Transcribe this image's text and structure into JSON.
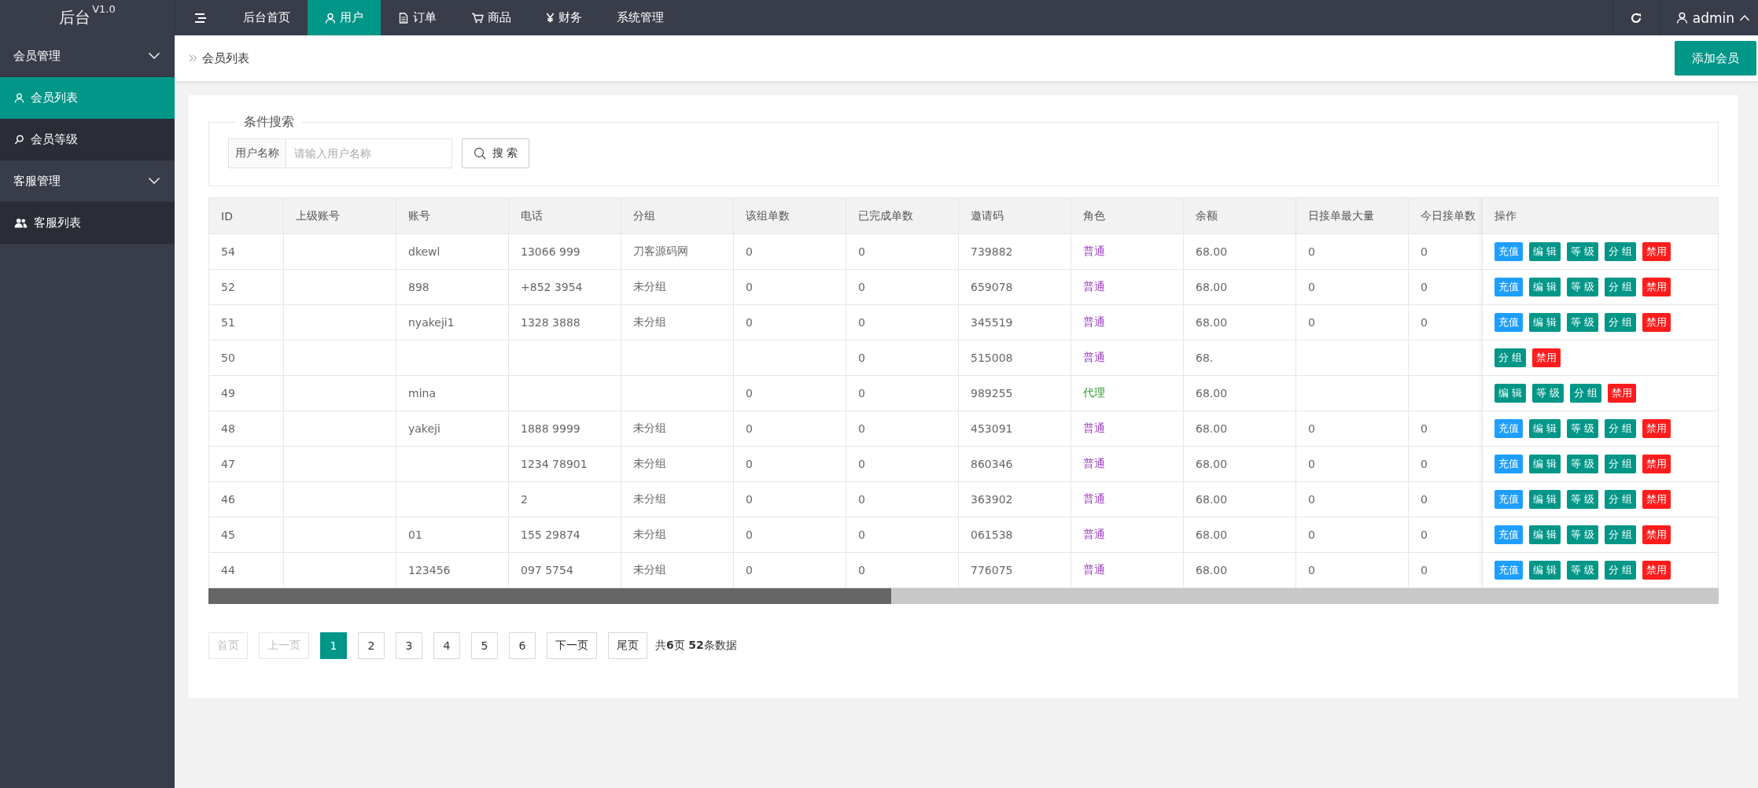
{
  "logo": {
    "text": "后台",
    "version": "V1.0"
  },
  "nav": [
    {
      "label": "后台首页",
      "selected": false
    },
    {
      "label": "用户",
      "selected": true
    },
    {
      "label": "订单",
      "selected": false
    },
    {
      "label": "商品",
      "selected": false
    },
    {
      "label": "财务",
      "selected": false
    },
    {
      "label": "系统管理",
      "selected": false
    }
  ],
  "user": {
    "name": "admin"
  },
  "sidebar": [
    {
      "label": "会员管理",
      "expanded": true,
      "children": [
        {
          "label": "会员列表",
          "selected": true
        },
        {
          "label": "会员等级",
          "selected": false
        }
      ]
    },
    {
      "label": "客服管理",
      "expanded": true,
      "children": [
        {
          "label": "客服列表",
          "selected": false
        }
      ]
    }
  ],
  "breadcrumb": "会员列表",
  "add_button": "添加会员",
  "search": {
    "legend": "条件搜索",
    "label": "用户名称",
    "placeholder": "请输入用户名称",
    "button": "搜 索"
  },
  "table": {
    "columns": [
      "ID",
      "上级账号",
      "账号",
      "电话",
      "分组",
      "该组单数",
      "已完成单数",
      "邀请码",
      "角色",
      "余额",
      "日接单最大量",
      "今日接单数"
    ],
    "action_column": "操作",
    "rows": [
      {
        "id": "54",
        "account": "dkewl",
        "phone": "13066 999",
        "group": "刀客源码网",
        "group_orders": "0",
        "done_orders": "0",
        "invite": "739882",
        "role": {
          "text": "普通",
          "color": "#9c3fc4"
        },
        "balance": "68.00",
        "daily_max": "0",
        "today_orders": "0",
        "actions": [
          {
            "label": "充值",
            "kind": "info"
          },
          {
            "label": "编 辑",
            "kind": "normal"
          },
          {
            "label": "等 级",
            "kind": "normal"
          },
          {
            "label": "分 组",
            "kind": "normal"
          },
          {
            "label": "禁用",
            "kind": "danger"
          }
        ]
      },
      {
        "id": "52",
        "account": "898",
        "phone": "+852 3954",
        "group": "未分组",
        "group_orders": "0",
        "done_orders": "0",
        "invite": "659078",
        "role": {
          "text": "普通",
          "color": "#9c3fc4"
        },
        "balance": "68.00",
        "daily_max": "0",
        "today_orders": "0",
        "actions": [
          {
            "label": "充值",
            "kind": "info"
          },
          {
            "label": "编 辑",
            "kind": "normal"
          },
          {
            "label": "等 级",
            "kind": "normal"
          },
          {
            "label": "分 组",
            "kind": "normal"
          },
          {
            "label": "禁用",
            "kind": "danger"
          }
        ]
      },
      {
        "id": "51",
        "account": "nyakeji1",
        "phone": "1328 3888",
        "group": "未分组",
        "group_orders": "0",
        "done_orders": "0",
        "invite": "345519",
        "role": {
          "text": "普通",
          "color": "#9c3fc4"
        },
        "balance": "68.00",
        "daily_max": "0",
        "today_orders": "0",
        "actions": [
          {
            "label": "充值",
            "kind": "info"
          },
          {
            "label": "编 辑",
            "kind": "normal"
          },
          {
            "label": "等 级",
            "kind": "normal"
          },
          {
            "label": "分 组",
            "kind": "normal"
          },
          {
            "label": "禁用",
            "kind": "danger"
          }
        ]
      },
      {
        "id": "50",
        "done_orders": "0",
        "invite": "515008",
        "role": {
          "text": "普通",
          "color": "#9c3fc4"
        },
        "balance": "68.",
        "actions": [
          {
            "label": "分 组",
            "kind": "normal"
          },
          {
            "label": "禁用",
            "kind": "danger"
          }
        ]
      },
      {
        "id": "49",
        "account": "mina",
        "group_orders": "0",
        "done_orders": "0",
        "invite": "989255",
        "role": {
          "text": "代理",
          "color": "#2a9a2a"
        },
        "balance": "68.00",
        "actions": [
          {
            "label": "编 辑",
            "kind": "normal"
          },
          {
            "label": "等 级",
            "kind": "normal"
          },
          {
            "label": "分 组",
            "kind": "normal"
          },
          {
            "label": "禁用",
            "kind": "danger"
          }
        ]
      },
      {
        "id": "48",
        "account": "yakeji",
        "phone": "1888 9999",
        "group": "未分组",
        "group_orders": "0",
        "done_orders": "0",
        "invite": "453091",
        "role": {
          "text": "普通",
          "color": "#9c3fc4"
        },
        "balance": "68.00",
        "daily_max": "0",
        "today_orders": "0",
        "actions": [
          {
            "label": "充值",
            "kind": "info"
          },
          {
            "label": "编 辑",
            "kind": "normal"
          },
          {
            "label": "等 级",
            "kind": "normal"
          },
          {
            "label": "分 组",
            "kind": "normal"
          },
          {
            "label": "禁用",
            "kind": "danger"
          }
        ]
      },
      {
        "id": "47",
        "phone": "1234 78901",
        "group": "未分组",
        "group_orders": "0",
        "done_orders": "0",
        "invite": "860346",
        "role": {
          "text": "普通",
          "color": "#9c3fc4"
        },
        "balance": "68.00",
        "daily_max": "0",
        "today_orders": "0",
        "actions": [
          {
            "label": "充值",
            "kind": "info"
          },
          {
            "label": "编 辑",
            "kind": "normal"
          },
          {
            "label": "等 级",
            "kind": "normal"
          },
          {
            "label": "分 组",
            "kind": "normal"
          },
          {
            "label": "禁用",
            "kind": "danger"
          }
        ]
      },
      {
        "id": "46",
        "phone": "2",
        "group": "未分组",
        "group_orders": "0",
        "done_orders": "0",
        "invite": "363902",
        "role": {
          "text": "普通",
          "color": "#9c3fc4"
        },
        "balance": "68.00",
        "daily_max": "0",
        "today_orders": "0",
        "actions": [
          {
            "label": "充值",
            "kind": "info"
          },
          {
            "label": "编 辑",
            "kind": "normal"
          },
          {
            "label": "等 级",
            "kind": "normal"
          },
          {
            "label": "分 组",
            "kind": "normal"
          },
          {
            "label": "禁用",
            "kind": "danger"
          }
        ]
      },
      {
        "id": "45",
        "account": "01",
        "phone": "155 29874",
        "group": "未分组",
        "group_orders": "0",
        "done_orders": "0",
        "invite": "061538",
        "role": {
          "text": "普通",
          "color": "#9c3fc4"
        },
        "balance": "68.00",
        "daily_max": "0",
        "today_orders": "0",
        "actions": [
          {
            "label": "充值",
            "kind": "info"
          },
          {
            "label": "编 辑",
            "kind": "normal"
          },
          {
            "label": "等 级",
            "kind": "normal"
          },
          {
            "label": "分 组",
            "kind": "normal"
          },
          {
            "label": "禁用",
            "kind": "danger"
          }
        ]
      },
      {
        "id": "44",
        "account": "123456",
        "phone": "097 5754",
        "group": "未分组",
        "group_orders": "0",
        "done_orders": "0",
        "invite": "776075",
        "role": {
          "text": "普通",
          "color": "#9c3fc4"
        },
        "balance": "68.00",
        "daily_max": "0",
        "today_orders": "0",
        "actions": [
          {
            "label": "充值",
            "kind": "info"
          },
          {
            "label": "编 辑",
            "kind": "normal"
          },
          {
            "label": "等 级",
            "kind": "normal"
          },
          {
            "label": "分 组",
            "kind": "normal"
          },
          {
            "label": "禁用",
            "kind": "danger"
          }
        ]
      }
    ]
  },
  "pagination": {
    "pages": [
      {
        "label": "首页",
        "disabled": true,
        "selected": false
      },
      {
        "label": "上一页",
        "disabled": true,
        "selected": false
      },
      {
        "label": "1",
        "disabled": false,
        "selected": true
      },
      {
        "label": "2",
        "disabled": false,
        "selected": false
      },
      {
        "label": "3",
        "disabled": false,
        "selected": false
      },
      {
        "label": "4",
        "disabled": false,
        "selected": false
      },
      {
        "label": "5",
        "disabled": false,
        "selected": false
      },
      {
        "label": "6",
        "disabled": false,
        "selected": false
      },
      {
        "label": "下一页",
        "disabled": false,
        "selected": false
      },
      {
        "label": "尾页",
        "disabled": false,
        "selected": false
      }
    ],
    "summary": "共**6**页 **52**条数据"
  }
}
